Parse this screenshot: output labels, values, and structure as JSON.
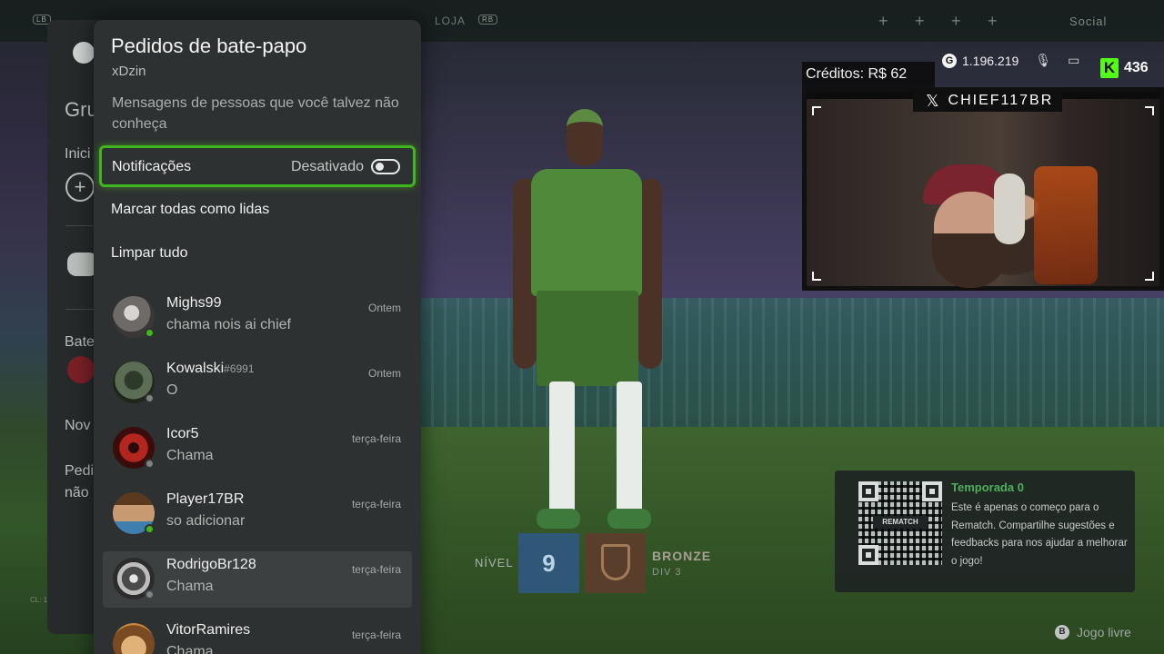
{
  "topnav": {
    "loja": "LOJA",
    "social": "Social"
  },
  "guide": {
    "title_fragment": "Gru",
    "items": [
      "Inici",
      "Bate",
      "Nov",
      "Pedi",
      "não"
    ],
    "footer": "CL: 1"
  },
  "panel": {
    "title": "Pedidos de bate-papo",
    "user": "xDzin",
    "description": "Mensagens de pessoas que você talvez não conheça",
    "notifications": {
      "label": "Notificações",
      "state": "Desativado"
    },
    "mark_all_read": "Marcar todas como lidas",
    "clear_all": "Limpar tudo",
    "requests": [
      {
        "name": "Mighs99",
        "tag": "",
        "message": "chama nois ai chief",
        "time": "Ontem",
        "online": true
      },
      {
        "name": "Kowalski",
        "tag": "#6991",
        "message": "O",
        "time": "Ontem",
        "online": false
      },
      {
        "name": "Icor5",
        "tag": "",
        "message": "Chama",
        "time": "terça-feira",
        "online": false
      },
      {
        "name": "Player17BR",
        "tag": "",
        "message": "so adicionar",
        "time": "terça-feira",
        "online": true
      },
      {
        "name": "RodrigoBr128",
        "tag": "",
        "message": "Chama",
        "time": "terça-feira",
        "online": false
      },
      {
        "name": "VitorRamires",
        "tag": "",
        "message": "Chama",
        "time": "terça-feira",
        "online": false
      }
    ]
  },
  "stream": {
    "credits": "Créditos: R$ 62",
    "gamerscore": "1.196.219",
    "kick_viewers": "436",
    "handle": "CHIEF117BR"
  },
  "game": {
    "level_label": "NÍVEL",
    "level": "9",
    "rank": "BRONZE",
    "division": "DIV 3",
    "season_title": "Temporada 0",
    "season_body": "Este é apenas o começo para o Rematch. Compartilhe sugestões e feedbacks para nos ajudar a melhorar o jogo!",
    "qr_label": "REMATCH",
    "hint_button": "B",
    "hint": "Jogo livre"
  },
  "colors": {
    "accent_green": "#3fb51f",
    "online": "#3fb51f",
    "kick": "#53fc18",
    "season_title": "#4fae5a"
  }
}
